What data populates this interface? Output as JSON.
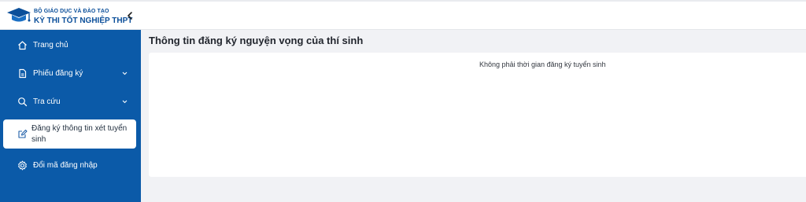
{
  "header": {
    "org_name": "BỘ GIÁO DỤC VÀ ĐÀO TẠO",
    "app_name": "KỲ THI TỐT NGHIỆP THPT",
    "collapse_icon": "chevron-left-icon",
    "brand_color": "#0b4f9a"
  },
  "sidebar": {
    "background": "#0b5aa8",
    "items": [
      {
        "label": "Trang chủ",
        "icon": "home-icon",
        "has_submenu": false
      },
      {
        "label": "Phiếu đăng ký",
        "icon": "document-icon",
        "has_submenu": true
      },
      {
        "label": "Tra cứu",
        "icon": "search-icon",
        "has_submenu": true
      },
      {
        "label": "Đăng ký thông tin xét tuyển sinh",
        "icon": "edit-icon",
        "has_submenu": false,
        "active": true
      },
      {
        "label": "Đổi mã đăng nhập",
        "icon": "gear-icon",
        "has_submenu": false
      }
    ]
  },
  "main": {
    "title": "Thông tin đăng ký nguyện vọng của thí sinh",
    "message": "Không phải thời gian đăng ký tuyển sinh"
  }
}
